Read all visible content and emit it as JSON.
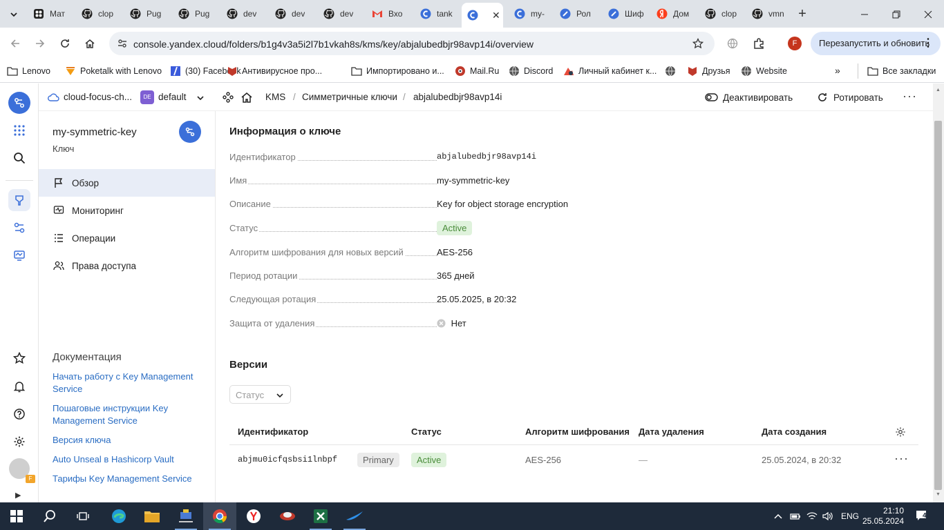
{
  "browser": {
    "tabs": [
      {
        "title": "Мат",
        "icon": "app-tab-icon"
      },
      {
        "title": "clop",
        "icon": "github-icon"
      },
      {
        "title": "Pug",
        "icon": "github-icon"
      },
      {
        "title": "Pug",
        "icon": "github-icon"
      },
      {
        "title": "dev",
        "icon": "github-icon"
      },
      {
        "title": "dev",
        "icon": "github-icon"
      },
      {
        "title": "dev",
        "icon": "github-icon"
      },
      {
        "title": "Вхо",
        "icon": "gmail-icon"
      },
      {
        "title": "tank",
        "icon": "yandex-cloud-icon"
      },
      {
        "title": "",
        "icon": "yandex-cloud-icon",
        "active": true
      },
      {
        "title": "my-",
        "icon": "yandex-cloud-icon"
      },
      {
        "title": "Рол",
        "icon": "yandex-docs-icon"
      },
      {
        "title": "Шиф",
        "icon": "yandex-docs-icon"
      },
      {
        "title": "Дом",
        "icon": "yandex-icon"
      },
      {
        "title": "clop",
        "icon": "github-icon"
      },
      {
        "title": "vmn",
        "icon": "github-icon"
      }
    ],
    "url": "console.yandex.cloud/folders/b1g4v3a5i2l7b1vkah8s/kms/key/abjalubedbjr98avp14i/overview",
    "profile_letter": "F",
    "relaunch_label": "Перезапустить и обновить",
    "bookmarks": [
      {
        "label": "Lenovo",
        "icon": "folder-icon"
      },
      {
        "label": "Poketalk with Lenovo",
        "icon": "poketalk-icon"
      },
      {
        "label": "(30) Facebook",
        "icon": "facebook-icon"
      },
      {
        "label": "Антивирусное про...",
        "icon": "mcafee-icon"
      },
      {
        "label": "Импортировано и...",
        "icon": "folder-icon"
      },
      {
        "label": "Mail.Ru",
        "icon": "mailru-icon"
      },
      {
        "label": "Discord",
        "icon": "globe-icon"
      },
      {
        "label": "Личный кабинет к...",
        "icon": "cabinet-icon"
      },
      {
        "label": "",
        "icon": "globe-icon"
      },
      {
        "label": "Друзья",
        "icon": "mcafee-icon"
      },
      {
        "label": "Website",
        "icon": "globe-icon"
      }
    ],
    "all_bookmarks_label": "Все закладки"
  },
  "console": {
    "cloud_name": "cloud-focus-ch...",
    "folder_badge": "DE",
    "folder_name": "default",
    "breadcrumb": {
      "service": "KMS",
      "section": "Симметричные ключи",
      "current": "abjalubedbjr98avp14i"
    },
    "actions": {
      "deactivate": "Деактивировать",
      "rotate": "Ротировать"
    },
    "user_badge": "F"
  },
  "sidebar": {
    "title": "my-symmetric-key",
    "subtitle": "Ключ",
    "menu": [
      {
        "label": "Обзор",
        "icon": "flag-icon",
        "active": true
      },
      {
        "label": "Мониторинг",
        "icon": "monitoring-icon"
      },
      {
        "label": "Операции",
        "icon": "list-icon"
      },
      {
        "label": "Права доступа",
        "icon": "users-icon"
      }
    ],
    "docs_title": "Документация",
    "docs": [
      "Начать работу с Key Management Service",
      "Пошаговые инструкции Key Management Service",
      "Версия ключа",
      "Auto Unseal в Hashicorp Vault",
      "Тарифы Key Management Service"
    ]
  },
  "info": {
    "title": "Информация о ключе",
    "fields": [
      {
        "label": "Идентификатор",
        "value": "abjalubedbjr98avp14i",
        "mono": true
      },
      {
        "label": "Имя",
        "value": "my-symmetric-key"
      },
      {
        "label": "Описание",
        "value": "Key for object storage encryption"
      },
      {
        "label": "Статус",
        "value": "Active",
        "badge": true
      },
      {
        "label": "Алгоритм шифрования для новых версий",
        "value": "AES-256"
      },
      {
        "label": "Период ротации",
        "value": "365 дней"
      },
      {
        "label": "Следующая ротация",
        "value": "25.05.2025, в 20:32"
      },
      {
        "label": "Защита от удаления",
        "value": "Нет",
        "icon": "close-circle-icon"
      }
    ]
  },
  "versions": {
    "title": "Версии",
    "filter_placeholder": "Статус",
    "columns": [
      "Идентификатор",
      "Статус",
      "Алгоритм шифрования",
      "Дата удаления",
      "Дата создания"
    ],
    "rows": [
      {
        "id": "abjmu0icfqsbsi1lnbpf",
        "tag": "Primary",
        "status": "Active",
        "algorithm": "AES-256",
        "deleted": "—",
        "created": "25.05.2024, в 20:32"
      }
    ]
  },
  "taskbar": {
    "language": "ENG",
    "time": "21:10",
    "date": "25.05.2024",
    "notifications": "4"
  },
  "colors": {
    "accent": "#3b6fd9",
    "link": "#2a6dc3",
    "active_green": "#4a8c3a"
  }
}
